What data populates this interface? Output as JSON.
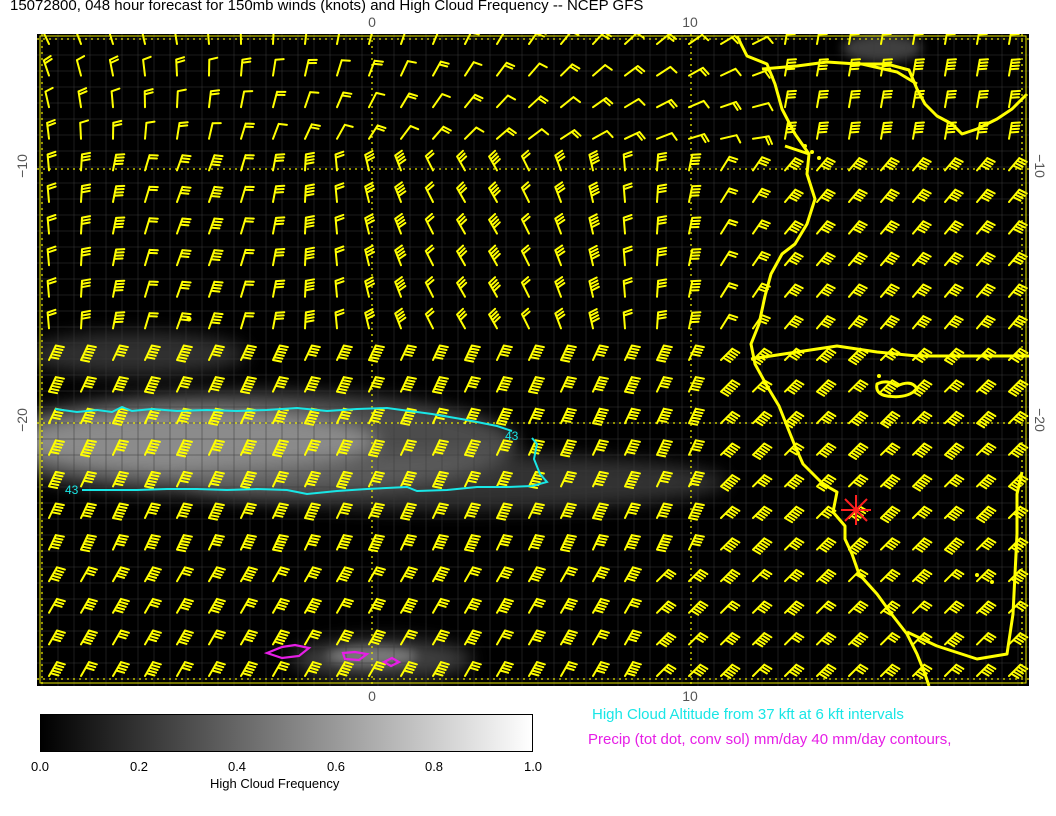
{
  "title": "15072800, 048 hour forecast for 150mb winds (knots) and High Cloud Frequency -- NCEP GFS",
  "axes": {
    "lon_ticks": [
      "0",
      "10"
    ],
    "lat_ticks": [
      "−10",
      "−20"
    ]
  },
  "contour_labels": [
    "43",
    "43"
  ],
  "colorbar": {
    "title": "High Cloud Frequency",
    "ticks": [
      "0.0",
      "0.2",
      "0.4",
      "0.6",
      "0.8",
      "1.0"
    ],
    "start_color": "#000000",
    "end_color": "#ffffff"
  },
  "legend": {
    "cloud_altitude": "High Cloud Altitude from 37 kft at 6 kft intervals",
    "precip": "Precip (tot dot, conv sol) mm/day 40 mm/day contours,"
  },
  "colors": {
    "background": "#000000",
    "wind_barb": "#ffff00",
    "coastline": "#ffff00",
    "cloud_altitude_contour": "#19e6e6",
    "precip_contour": "#e61ee6",
    "marker": "#ff0000"
  },
  "markers": [
    {
      "name": "red-star-marker",
      "symbol": "asterisk"
    }
  ]
}
